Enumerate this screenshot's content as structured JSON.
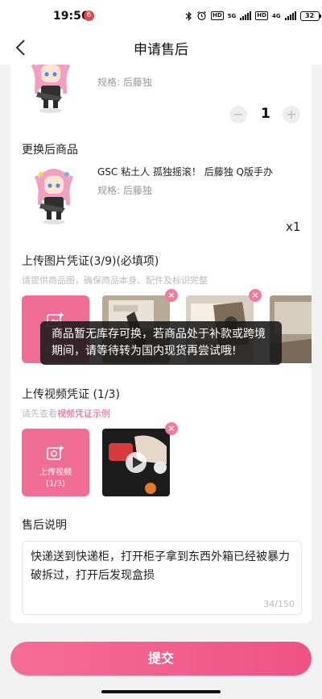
{
  "status": {
    "time": "19:56",
    "notif": "6",
    "battery": "32",
    "net1": "5G",
    "net2": "4G"
  },
  "nav": {
    "title": "申请售后"
  },
  "original_item": {
    "spec": "规格: 后藤独",
    "quantity": "1",
    "minus": "−",
    "plus": "+"
  },
  "replacement": {
    "section_title": "更换后商品",
    "name": "GSC 粘土人 孤独摇滚！ 后藤独 Q版手办",
    "spec": "规格: 后藤独",
    "qty": "x1"
  },
  "image_upload": {
    "title": "上传图片凭证(3/9)(必填项)",
    "hint": "请提供商品图，确保商品本身、配件及标识完整",
    "tile_label": "上",
    "tile_count": "(3/9)"
  },
  "toast": {
    "text": "商品暂无库存可换，若商品处于补款或跨境期间，请等待转为国内现货再尝试哦!"
  },
  "video_upload": {
    "title": "上传视频凭证 (1/3)",
    "hint_prefix": "请先查看",
    "hint_link": "视频凭证示例",
    "tile_label": "上传视频",
    "tile_count": "(1/3)"
  },
  "description": {
    "title": "售后说明",
    "text": "快递送到快递柜，打开柜子拿到东西外箱已经被暴力破拆过，打开后发现盒损",
    "count": "34/150"
  },
  "submit": {
    "label": "提交"
  },
  "colors": {
    "accent": "#f06d96",
    "link": "#e8538a",
    "button_start": "#f56e98",
    "button_end": "#ef5285"
  }
}
